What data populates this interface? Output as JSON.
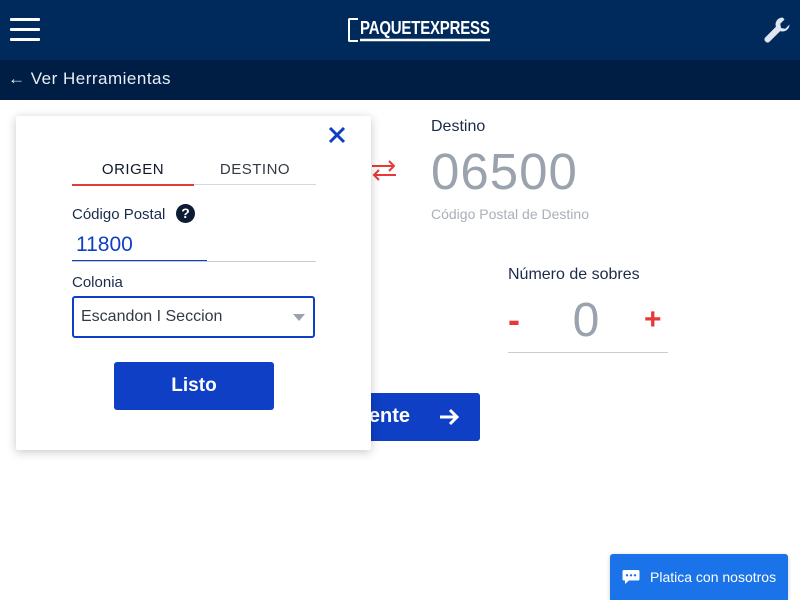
{
  "header": {
    "brand": "PAQUETEXPRESS",
    "menu_icon": "hamburger-icon",
    "tools_icon": "wrench-icon",
    "colors": {
      "primary": "#012a5c",
      "secondary": "#001e44"
    }
  },
  "subheader": {
    "back_link": "← Ver Herramientas"
  },
  "destination": {
    "label": "Destino",
    "postal_code": "06500",
    "caption": "Código Postal de Destino"
  },
  "envelopes": {
    "label": "Número de sobres",
    "minus": "-",
    "value": "0",
    "plus": "+"
  },
  "next_button": {
    "label": "Siguiente"
  },
  "modal": {
    "tabs": [
      {
        "label": "ORIGEN"
      },
      {
        "label": "DESTINO"
      }
    ],
    "postal_label": "Código Postal",
    "help": "?",
    "postal_value": "11800",
    "colonia_label": "Colonia",
    "colonia_value": "Escandon I Seccion",
    "done_label": "Listo",
    "colors": {
      "accent": "#0f3fc4",
      "tab_underline": "#e53a37"
    }
  },
  "chat": {
    "label": "Platica con nosotros",
    "color": "#1a73e8"
  }
}
